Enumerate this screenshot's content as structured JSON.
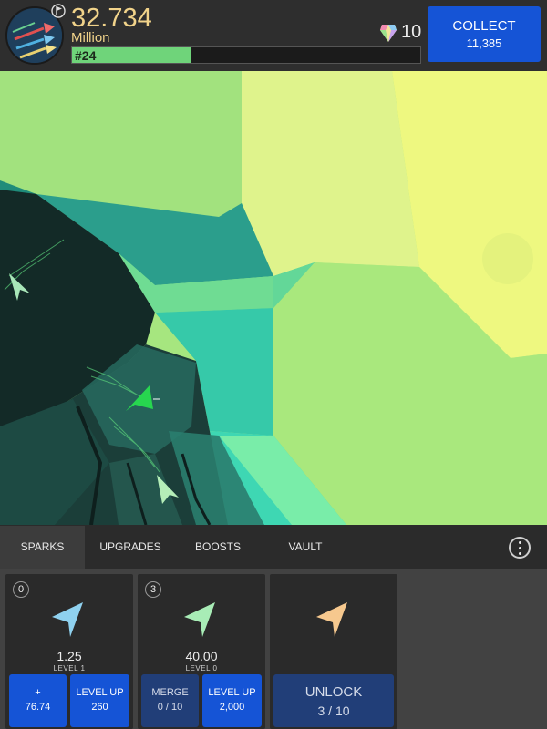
{
  "header": {
    "score": "32.734",
    "score_unit": "Million",
    "progress_label": "#24",
    "progress_fraction": 0.34,
    "gems": "10",
    "collect": {
      "label": "COLLECT",
      "value": "11,385"
    }
  },
  "tabs": [
    {
      "label": "SPARKS",
      "active": true
    },
    {
      "label": "UPGRADES",
      "active": false
    },
    {
      "label": "BOOSTS",
      "active": false
    },
    {
      "label": "VAULT",
      "active": false
    }
  ],
  "cards": [
    {
      "count": "0",
      "value": "1.25",
      "level": "LEVEL 1",
      "color": "#8fd1ef",
      "buttons": [
        {
          "line1": "+",
          "line2": "76.74"
        },
        {
          "line1": "LEVEL UP",
          "line2": "260"
        }
      ]
    },
    {
      "count": "3",
      "value": "40.00",
      "level": "LEVEL 0",
      "color": "#a8ecb6",
      "buttons": [
        {
          "line1": "MERGE",
          "line2": "0 / 10"
        },
        {
          "line1": "LEVEL UP",
          "line2": "2,000"
        }
      ]
    },
    {
      "color": "#f6c88e",
      "buttons": [
        {
          "line1": "UNLOCK",
          "line2": "3 / 10"
        }
      ]
    }
  ],
  "colors": {
    "accent_button": "#1554d6",
    "score_text": "#f1d38a",
    "progress_fill": "#6fd47a"
  }
}
